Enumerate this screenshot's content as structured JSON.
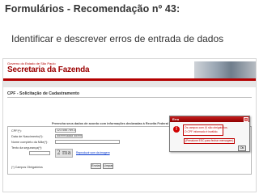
{
  "slide": {
    "title": "Formulários - Recomendação nº 43:",
    "subtitle": "Identificar e descrever erros de entrada de dados"
  },
  "site": {
    "logo_top": "Governo do Estado de São Paulo",
    "logo_main": "Secretaria da Fazenda",
    "brand_color": "#9b0000"
  },
  "page": {
    "heading": "CPF - Solicitação de Cadastramento",
    "info": "Preencha seus dados de acordo com informações declaradas à Receita Federal do Brasil"
  },
  "form": {
    "fields": [
      {
        "label": "CPF(*):",
        "value": "123.456.789-10"
      },
      {
        "label": "Data de Nascimento(*):",
        "value": "dd/mm/aaaa  dd/mm/aaaa"
      },
      {
        "label": "Nome completo da Mãe(*):",
        "value": ""
      },
      {
        "label": "Texto da segurança(*):",
        "value": ""
      }
    ],
    "captcha_text": "2 ma",
    "captcha_link": "Reproduzir som da imagem",
    "submit_label": "Enviar",
    "clear_label": "Limpar",
    "required_note": "(*) Campos Obrigatórios"
  },
  "dialog": {
    "title": "Erro",
    "close_glyph": "x",
    "icon_glyph": "!",
    "messages": [
      "Os campos com (*) são obrigatórios.",
      "O CPF informado é inválido."
    ],
    "hint": "(Pressione ESC para fechar mensagem)",
    "ok_label": "Ok"
  }
}
